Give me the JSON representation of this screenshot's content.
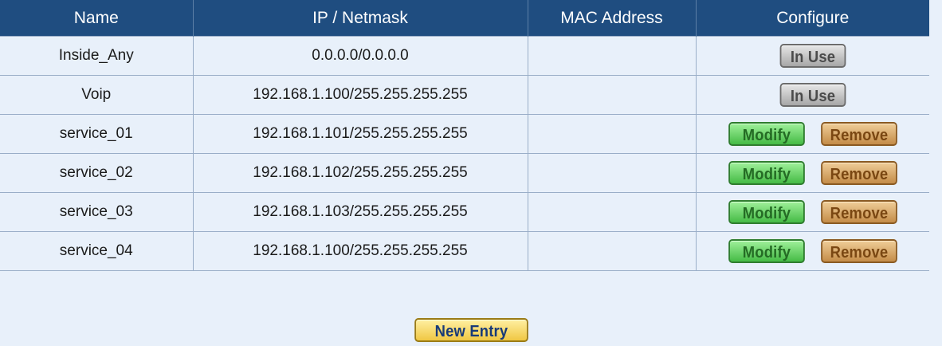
{
  "table": {
    "headers": [
      "Name",
      "IP / Netmask",
      "MAC Address",
      "Configure"
    ],
    "rows": [
      {
        "name": "Inside_Any",
        "ip": "0.0.0.0/0.0.0.0",
        "mac": "",
        "actions": [
          "In Use"
        ]
      },
      {
        "name": "Voip",
        "ip": "192.168.1.100/255.255.255.255",
        "mac": "",
        "actions": [
          "In Use"
        ]
      },
      {
        "name": "service_01",
        "ip": "192.168.1.101/255.255.255.255",
        "mac": "",
        "actions": [
          "Modify",
          "Remove"
        ]
      },
      {
        "name": "service_02",
        "ip": "192.168.1.102/255.255.255.255",
        "mac": "",
        "actions": [
          "Modify",
          "Remove"
        ]
      },
      {
        "name": "service_03",
        "ip": "192.168.1.103/255.255.255.255",
        "mac": "",
        "actions": [
          "Modify",
          "Remove"
        ]
      },
      {
        "name": "service_04",
        "ip": "192.168.1.100/255.255.255.255",
        "mac": "",
        "actions": [
          "Modify",
          "Remove"
        ]
      }
    ]
  },
  "new_entry_label": "New Entry",
  "colors": {
    "header_bg": "#1f4d80",
    "row_bg": "#e8f0fa",
    "in_use": "#a7a7a7",
    "modify": "#45bb45",
    "remove": "#c48c48",
    "new_entry": "#f0c743"
  }
}
